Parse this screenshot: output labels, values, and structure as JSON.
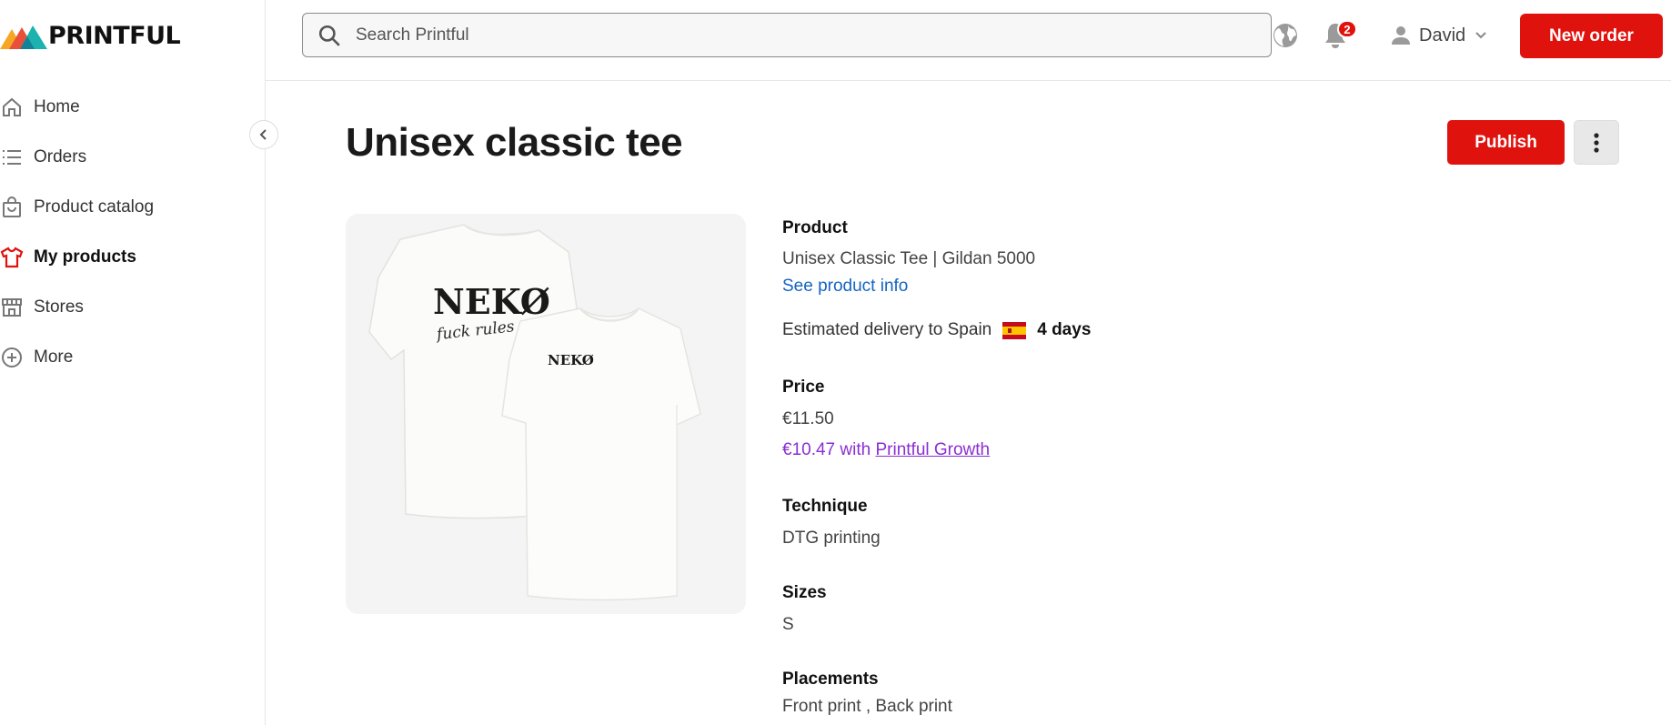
{
  "brand": {
    "name": "PRINTFUL"
  },
  "sidebar": {
    "items": [
      {
        "label": "Home",
        "icon": "home-icon",
        "active": false
      },
      {
        "label": "Orders",
        "icon": "list-icon",
        "active": false
      },
      {
        "label": "Product catalog",
        "icon": "shopping-bag-icon",
        "active": false
      },
      {
        "label": "My products",
        "icon": "tshirt-icon",
        "active": true
      },
      {
        "label": "Stores",
        "icon": "store-icon",
        "active": false
      },
      {
        "label": "More",
        "icon": "plus-circle-icon",
        "active": false
      }
    ]
  },
  "topbar": {
    "search_placeholder": "Search Printful",
    "notifications_count": "2",
    "user_name": "David",
    "new_order_label": "New order"
  },
  "page": {
    "title": "Unisex classic tee",
    "publish_label": "Publish"
  },
  "product_image": {
    "back_print_text": "NEKØ",
    "back_print_subtext": "fuck rules",
    "front_print_text": "NEKØ"
  },
  "details": {
    "product_label": "Product",
    "product_value": "Unisex Classic Tee | Gildan 5000",
    "product_link": "See product info",
    "delivery_text": "Estimated delivery to Spain",
    "delivery_days": "4 days",
    "price_label": "Price",
    "price_value": "€11.50",
    "growth_price": "€10.47 with",
    "growth_link": "Printful Growth",
    "technique_label": "Technique",
    "technique_value": "DTG printing",
    "sizes_label": "Sizes",
    "sizes_value": "S",
    "placements_label": "Placements",
    "placements_value": "Front print , Back print"
  },
  "colors": {
    "brand_red": "#e0120e",
    "link_blue": "#1565c0",
    "growth_purple": "#8a2fd1"
  }
}
